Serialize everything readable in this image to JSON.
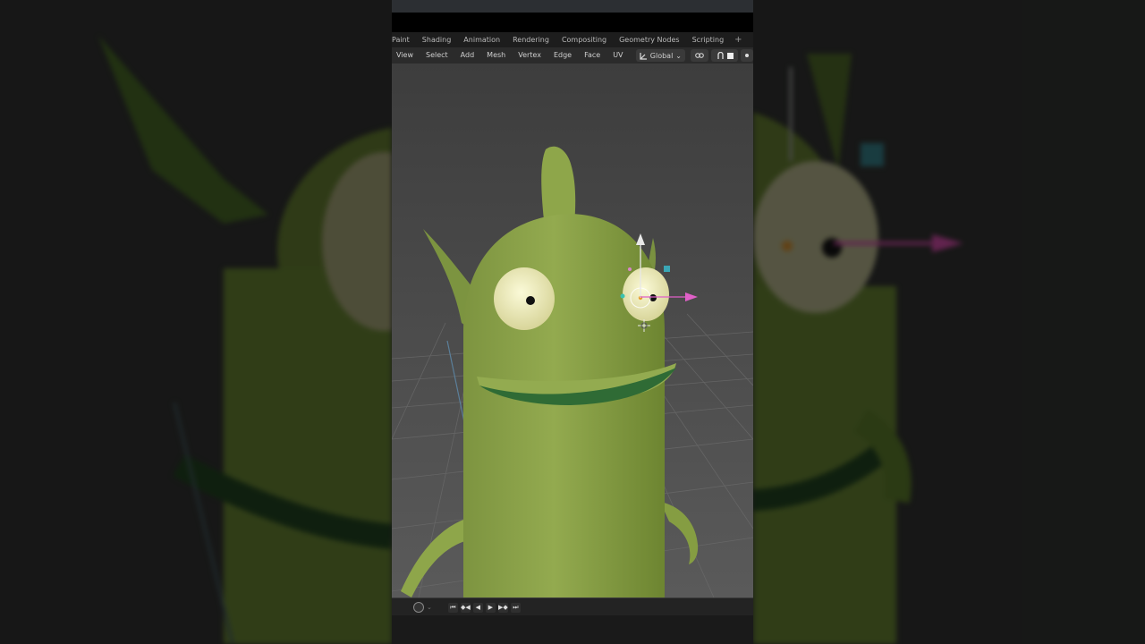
{
  "workspace_tabs": [
    "Paint",
    "Shading",
    "Animation",
    "Rendering",
    "Compositing",
    "Geometry Nodes",
    "Scripting"
  ],
  "header_menus": [
    "View",
    "Select",
    "Add",
    "Mesh",
    "Vertex",
    "Edge",
    "Face",
    "UV"
  ],
  "transform_orientation": "Global",
  "icons": {
    "add_workspace": "+",
    "orientation": "transform-orientation-icon",
    "snap": "snap-icon",
    "proportional": "proportional-editing-icon"
  },
  "timeline_controls": [
    "⏮",
    "◆◀",
    "◀",
    "▶",
    "▶◆",
    "⏭"
  ],
  "colors": {
    "character": "#8ea64a",
    "character_shade": "#6f8a33",
    "mouth": "#2f6b35",
    "eye": "#f1efb8",
    "gizmo_x": "#e060c8",
    "gizmo_y": "#ffffff",
    "gizmo_z": "#3aa6b5"
  }
}
